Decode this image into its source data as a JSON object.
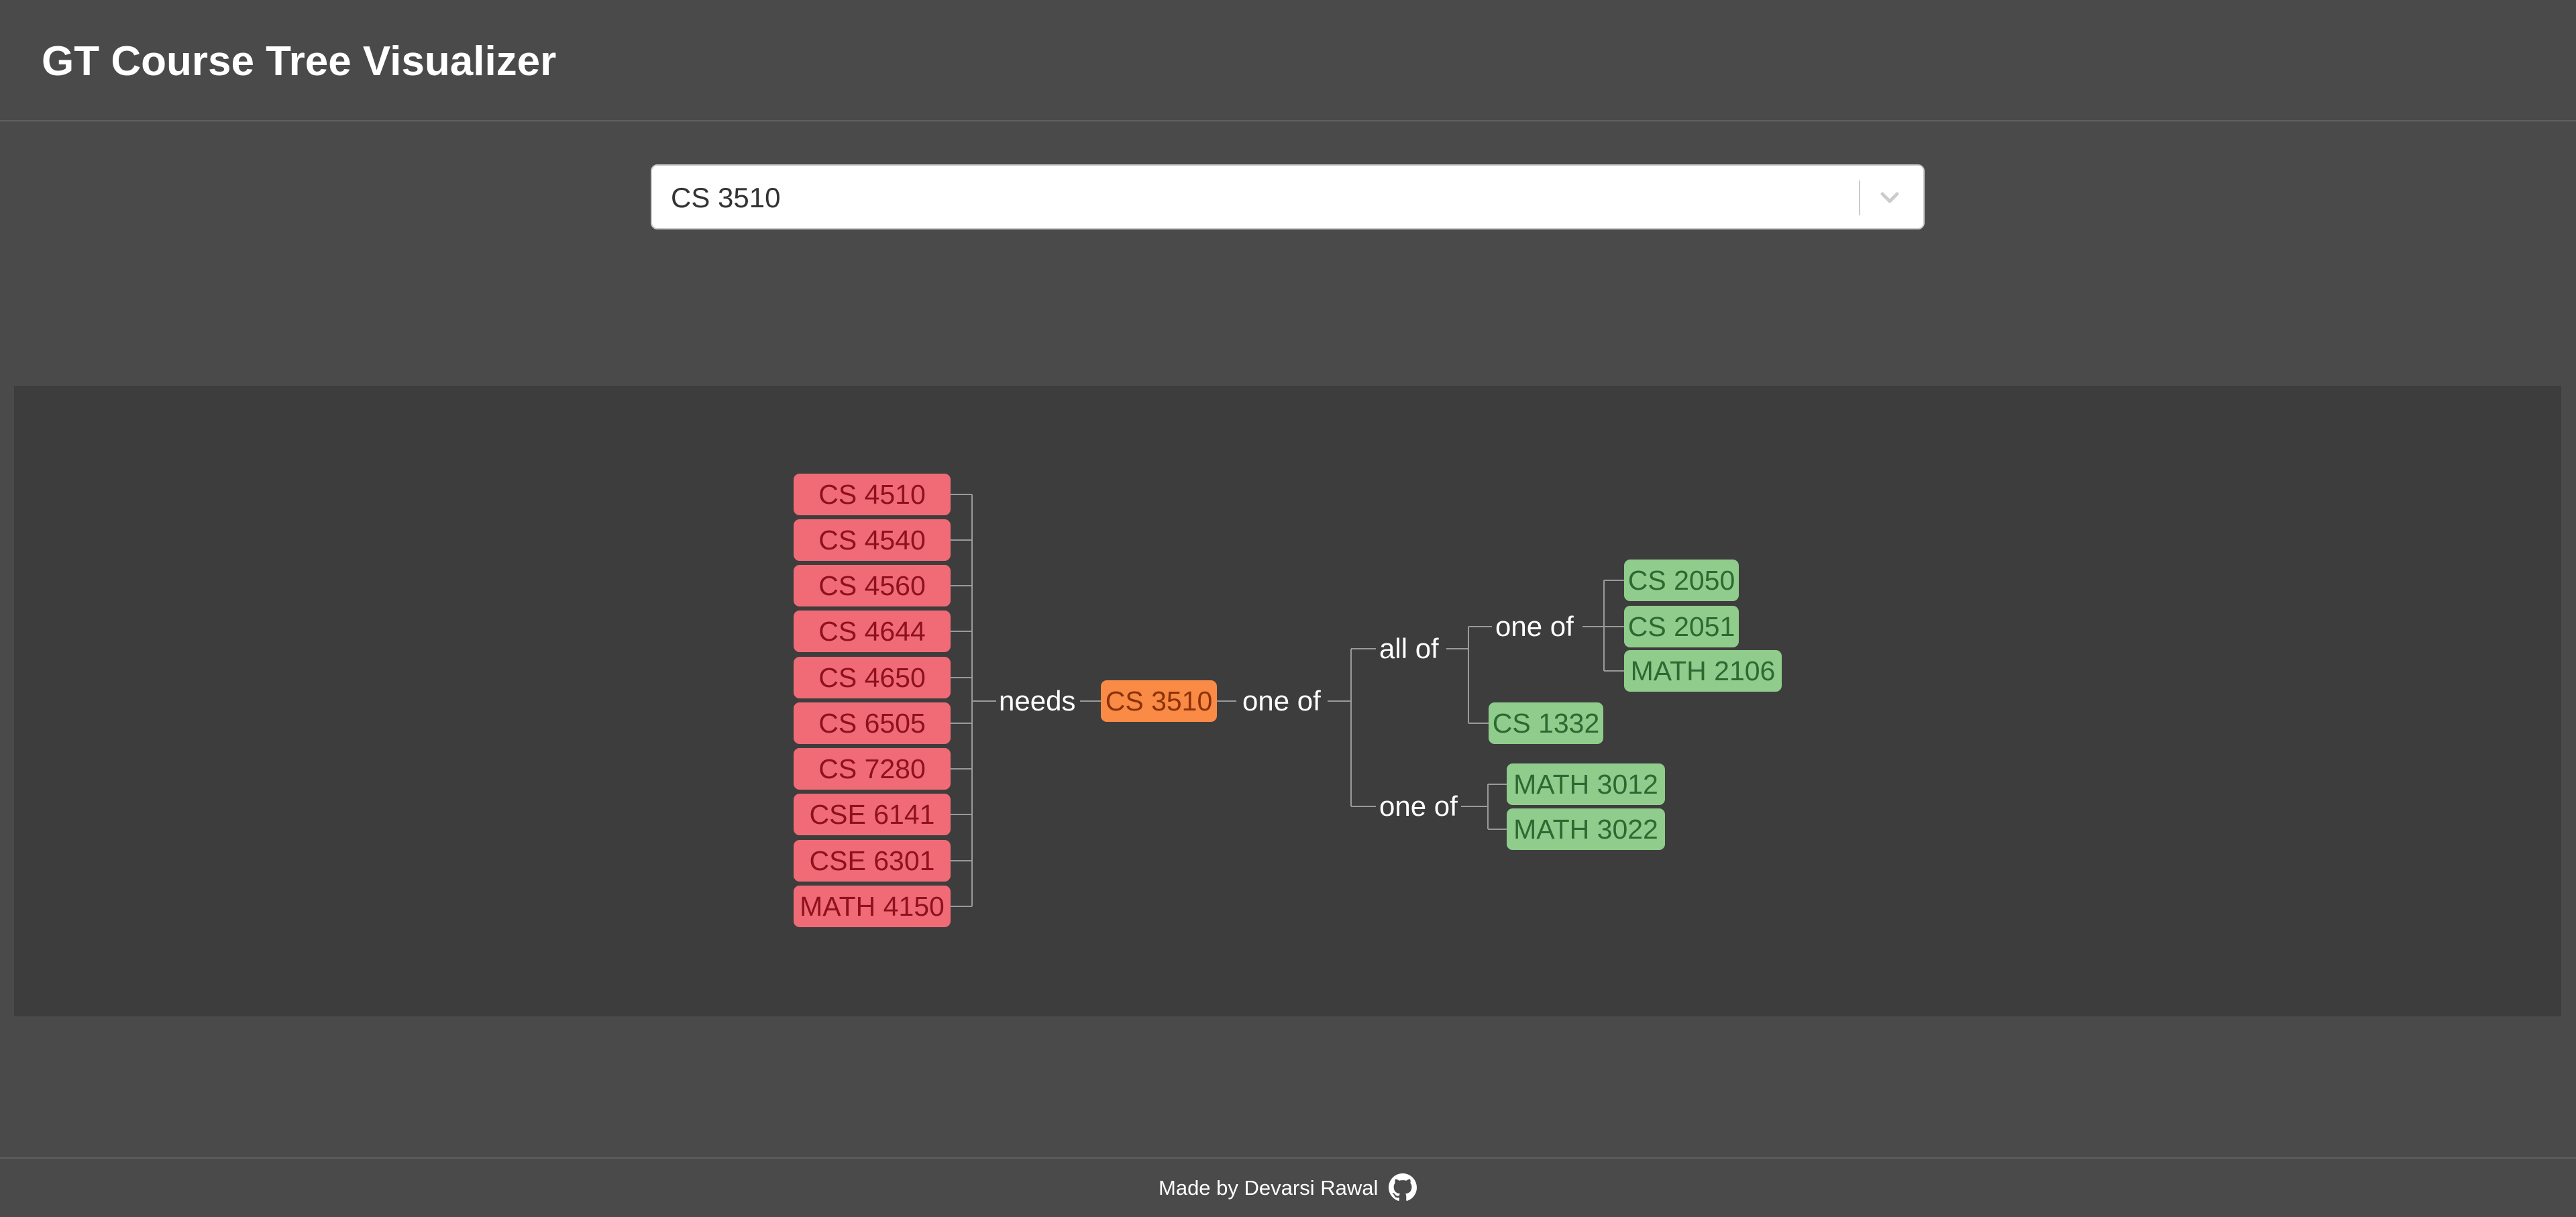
{
  "app": {
    "title": "GT Course Tree Visualizer"
  },
  "course_select": {
    "value": "CS 3510",
    "icon": "chevron-down-icon"
  },
  "tree": {
    "selected_course": "CS 3510",
    "needed_by_label": "needs",
    "needed_by": [
      "CS 4510",
      "CS 4540",
      "CS 4560",
      "CS 4644",
      "CS 4650",
      "CS 6505",
      "CS 7280",
      "CSE 6141",
      "CSE 6301",
      "MATH 4150"
    ],
    "prereq_root_label": "one of",
    "all_of_label": "all of",
    "all_of_one_of_label": "one of",
    "all_of_one_of_courses": [
      "CS 2050",
      "CS 2051",
      "MATH 2106"
    ],
    "all_of_course": "CS 1332",
    "second_one_of_label": "one of",
    "second_one_of_courses": [
      "MATH 3012",
      "MATH 3022"
    ]
  },
  "colors": {
    "needed_by": "#f06b76",
    "selected": "#f98b46",
    "prerequisite": "#90cc8b"
  },
  "footer": {
    "text": "Made by Devarsi Rawal",
    "icon": "github-icon"
  }
}
